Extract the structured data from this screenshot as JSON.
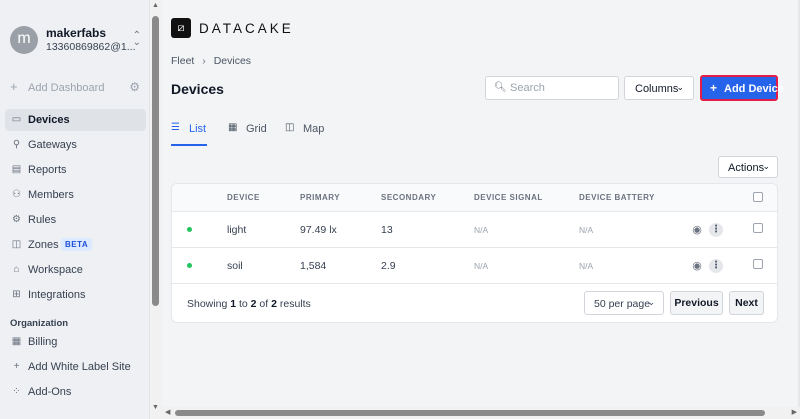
{
  "sidebar": {
    "user": {
      "avatar_letter": "m",
      "name": "makerfabs",
      "email": "13360869862@1..."
    },
    "add_dashboard": "Add Dashboard",
    "items": [
      {
        "label": "Devices",
        "icon": "devices-icon",
        "glyph": "▭"
      },
      {
        "label": "Gateways",
        "icon": "gateway-icon",
        "glyph": "⚲"
      },
      {
        "label": "Reports",
        "icon": "report-icon",
        "glyph": "▤"
      },
      {
        "label": "Members",
        "icon": "members-icon",
        "glyph": "⚇"
      },
      {
        "label": "Rules",
        "icon": "rules-icon",
        "glyph": "⚙"
      },
      {
        "label": "Zones",
        "icon": "map-icon",
        "glyph": "◫"
      },
      {
        "label": "Workspace",
        "icon": "home-icon",
        "glyph": "⌂"
      },
      {
        "label": "Integrations",
        "icon": "integrations-icon",
        "glyph": "⊞"
      }
    ],
    "zones_badge": "BETA",
    "section_label": "Organization",
    "org_items": [
      {
        "label": "Billing",
        "icon": "billing-icon",
        "glyph": "▦"
      },
      {
        "label": "Add White Label Site",
        "icon": "plus-icon",
        "glyph": "+"
      },
      {
        "label": "Add-Ons",
        "icon": "addons-icon",
        "glyph": "⁘"
      }
    ]
  },
  "header": {
    "logo_glyph": "⧄",
    "logo_text": "DATACAKE",
    "breadcrumb": [
      "Fleet",
      "Devices"
    ],
    "title": "Devices"
  },
  "toolbar": {
    "search_placeholder": "Search",
    "columns_label": "Columns",
    "add_device_label": "Add Device",
    "actions_label": "Actions"
  },
  "tabs": [
    {
      "label": "List",
      "active": true
    },
    {
      "label": "Grid",
      "active": false
    },
    {
      "label": "Map",
      "active": false
    }
  ],
  "table": {
    "columns": [
      "DEVICE",
      "PRIMARY",
      "SECONDARY",
      "DEVICE SIGNAL",
      "DEVICE BATTERY"
    ],
    "rows": [
      {
        "device": "light",
        "primary": "97.49 lx",
        "secondary": "13",
        "signal": "N/A",
        "battery": "N/A",
        "status_color": "#22c55e"
      },
      {
        "device": "soil",
        "primary": "1,584",
        "secondary": "2.9",
        "signal": "N/A",
        "battery": "N/A",
        "status_color": "#22c55e"
      }
    ]
  },
  "pagination": {
    "showing_prefix": "Showing",
    "from": "1",
    "to_word": "to",
    "to": "2",
    "of_word": "of",
    "total": "2",
    "results_word": "results",
    "per_page": "50 per page",
    "previous": "Previous",
    "next": "Next"
  },
  "colors": {
    "accent": "#2563eb",
    "highlight_border": "#e11d48",
    "online": "#22c55e"
  }
}
